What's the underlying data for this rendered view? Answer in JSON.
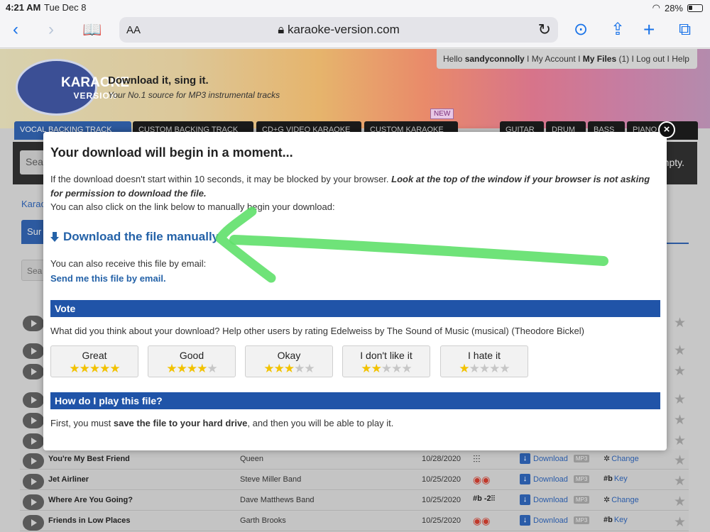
{
  "status_bar": {
    "time": "4:21 AM",
    "date": "Tue Dec 8",
    "battery": "28%"
  },
  "browser": {
    "text_size_label": "AA",
    "url": "karaoke-version.com"
  },
  "site": {
    "logo_line1": "KARAOKE",
    "logo_line2": "VERSION",
    "tagline": "Download it, sing it.",
    "subtagline": "Your No.1 source for MP3 instrumental tracks",
    "user_bar": {
      "greeting": "Hello ",
      "username": "sandyconnolly",
      "my_account": "My Account",
      "my_files": "My Files",
      "files_count": "(1)",
      "log_out": "Log out",
      "help": "Help",
      "separator": " I "
    },
    "new_badge": "NEW",
    "nav_tabs": [
      {
        "label": "VOCAL BACKING TRACK"
      },
      {
        "label": "CUSTOM BACKING TRACK"
      },
      {
        "label": "CD+G VIDEO KARAOKE"
      },
      {
        "label": "CUSTOM KARAOKE"
      },
      {
        "label": "GUITAR"
      },
      {
        "label": "DRUM"
      },
      {
        "label": "BASS"
      },
      {
        "label": "PIANO"
      }
    ],
    "search_stub": "Sea",
    "empty_stub": "mpty.",
    "breadcrumb_stub": "Karao",
    "subtab_stub": "Sur",
    "filter_stub": "Sea"
  },
  "songs": [
    {
      "title": "You're My Best Friend",
      "artist": "Queen",
      "date": "10/28/2020",
      "tool": "⫶⫶⫶",
      "download": "Download",
      "format": "MP3",
      "action_symbol": "✲",
      "action": "Change"
    },
    {
      "title": "Jet Airliner",
      "artist": "Steve Miller Band",
      "date": "10/25/2020",
      "tool": "◉◉",
      "download": "Download",
      "format": "MP3",
      "action_symbol": "#b",
      "action": "Key"
    },
    {
      "title": "Where Are You Going?",
      "artist": "Dave Matthews Band",
      "date": "10/25/2020",
      "tool": "#b -2⫶⫶",
      "download": "Download",
      "format": "MP3",
      "action_symbol": "✲",
      "action": "Change"
    },
    {
      "title": "Friends in Low Places",
      "artist": "Garth Brooks",
      "date": "10/25/2020",
      "tool": "◉◉",
      "download": "Download",
      "format": "MP3",
      "action_symbol": "#b",
      "action": "Key"
    }
  ],
  "modal": {
    "close_label": "×",
    "title": "Your download will begin in a moment...",
    "para1_plain": "If the download doesn't start within 10 seconds, it may be blocked by your browser. ",
    "para1_emph": "Look at the top of the window if your browser is not asking for permission to download the file.",
    "para2": "You can also click on the link below to manually begin your download:",
    "download_link": "Download the file manually",
    "para3": "You can also receive this file by email:",
    "email_link": "Send me this file by email.",
    "vote_heading": "Vote",
    "vote_question": "What did you think about your download? Help other users by rating Edelweiss by The Sound of Music (musical) (Theodore Bickel)",
    "ratings": [
      {
        "label": "Great",
        "stars": 5
      },
      {
        "label": "Good",
        "stars": 4
      },
      {
        "label": "Okay",
        "stars": 3
      },
      {
        "label": "I don't like it",
        "stars": 2
      },
      {
        "label": "I hate it",
        "stars": 1
      }
    ],
    "play_heading": "How do I play this file?",
    "play_text_before": "First, you must ",
    "play_text_bold": "save the file to your hard drive",
    "play_text_after": ", and then you will be able to play it."
  },
  "colors": {
    "accent": "#2054a8",
    "link": "#2462a8",
    "star_on": "#f2c200",
    "star_off": "#c6c6c6",
    "annotation": "#5fe06a"
  }
}
